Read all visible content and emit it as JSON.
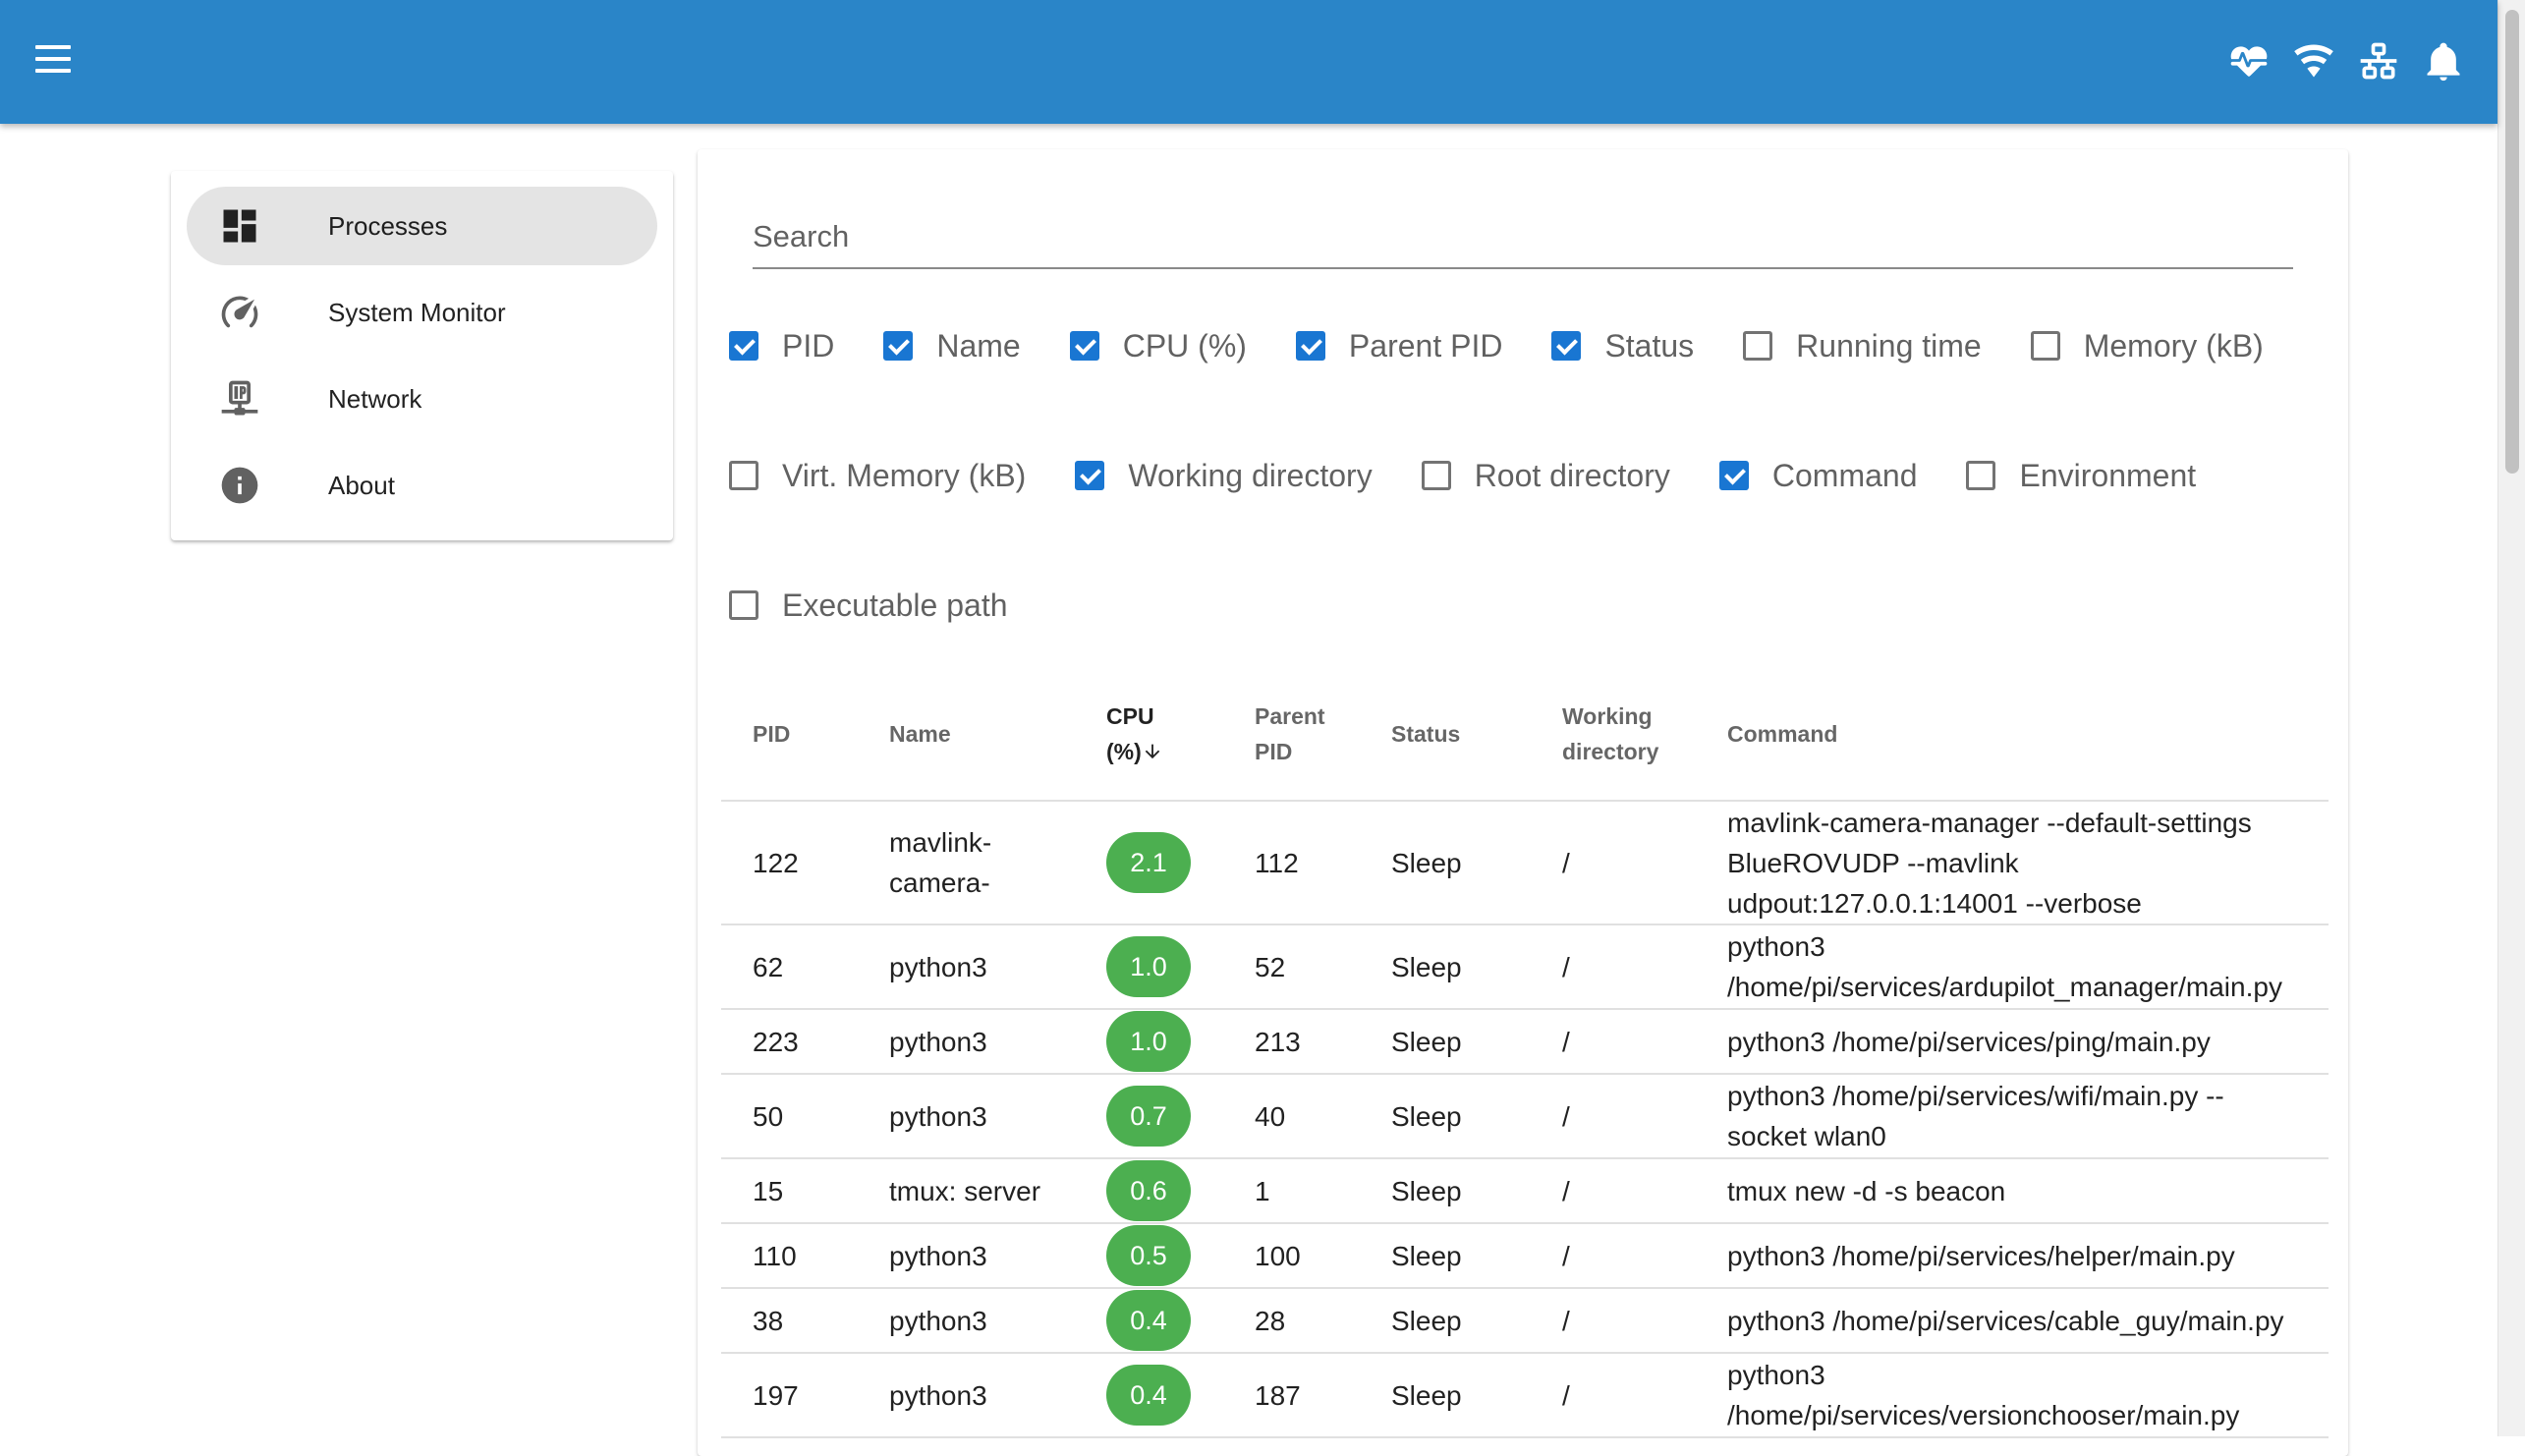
{
  "appbar": {
    "icons": [
      "heart-pulse-icon",
      "wifi-icon",
      "lan-icon",
      "bell-icon"
    ]
  },
  "nav": {
    "items": [
      {
        "label": "Processes",
        "icon": "view-dashboard-icon",
        "active": true
      },
      {
        "label": "System Monitor",
        "icon": "speedometer-icon",
        "active": false
      },
      {
        "label": "Network",
        "icon": "ip-network-icon",
        "active": false
      },
      {
        "label": "About",
        "icon": "information-icon",
        "active": false
      }
    ]
  },
  "search": {
    "placeholder": "Search",
    "value": ""
  },
  "columns": [
    {
      "label": "PID",
      "checked": true
    },
    {
      "label": "Name",
      "checked": true
    },
    {
      "label": "CPU (%)",
      "checked": true
    },
    {
      "label": "Parent PID",
      "checked": true
    },
    {
      "label": "Status",
      "checked": true
    },
    {
      "label": "Running time",
      "checked": false
    },
    {
      "label": "Memory (kB)",
      "checked": false
    },
    {
      "label": "Virt. Memory (kB)",
      "checked": false
    },
    {
      "label": "Working directory",
      "checked": true
    },
    {
      "label": "Root directory",
      "checked": false
    },
    {
      "label": "Command",
      "checked": true
    },
    {
      "label": "Environment",
      "checked": false
    },
    {
      "label": "Executable path",
      "checked": false
    }
  ],
  "table": {
    "headers": {
      "pid": "PID",
      "name": "Name",
      "cpu": "CPU (%)",
      "parent_pid": "Parent PID",
      "status": "Status",
      "working_directory": "Working directory",
      "command": "Command"
    },
    "sort": {
      "column": "cpu",
      "direction": "descending"
    },
    "rows": [
      {
        "pid": "122",
        "name": "mavlink-camera-",
        "cpu": "2.1",
        "parent_pid": "112",
        "status": "Sleep",
        "working_directory": "/",
        "command": "mavlink-camera-manager --default-settings BlueROVUDP --mavlink udpout:127.0.0.1:14001 --verbose"
      },
      {
        "pid": "62",
        "name": "python3",
        "cpu": "1.0",
        "parent_pid": "52",
        "status": "Sleep",
        "working_directory": "/",
        "command": "python3 /home/pi/services/ardupilot_manager/main.py"
      },
      {
        "pid": "223",
        "name": "python3",
        "cpu": "1.0",
        "parent_pid": "213",
        "status": "Sleep",
        "working_directory": "/",
        "command": "python3 /home/pi/services/ping/main.py"
      },
      {
        "pid": "50",
        "name": "python3",
        "cpu": "0.7",
        "parent_pid": "40",
        "status": "Sleep",
        "working_directory": "/",
        "command": "python3 /home/pi/services/wifi/main.py --socket wlan0"
      },
      {
        "pid": "15",
        "name": "tmux: server",
        "cpu": "0.6",
        "parent_pid": "1",
        "status": "Sleep",
        "working_directory": "/",
        "command": "tmux new -d -s beacon"
      },
      {
        "pid": "110",
        "name": "python3",
        "cpu": "0.5",
        "parent_pid": "100",
        "status": "Sleep",
        "working_directory": "/",
        "command": "python3 /home/pi/services/helper/main.py"
      },
      {
        "pid": "38",
        "name": "python3",
        "cpu": "0.4",
        "parent_pid": "28",
        "status": "Sleep",
        "working_directory": "/",
        "command": "python3 /home/pi/services/cable_guy/main.py"
      },
      {
        "pid": "197",
        "name": "python3",
        "cpu": "0.4",
        "parent_pid": "187",
        "status": "Sleep",
        "working_directory": "/",
        "command": "python3 /home/pi/services/versionchooser/main.py"
      }
    ]
  },
  "colors": {
    "appbar": "#2a85c8",
    "checkbox_checked": "#1976d2",
    "cpu_chip": "#4caf50",
    "nav_active_bg": "#e4e4e4"
  }
}
